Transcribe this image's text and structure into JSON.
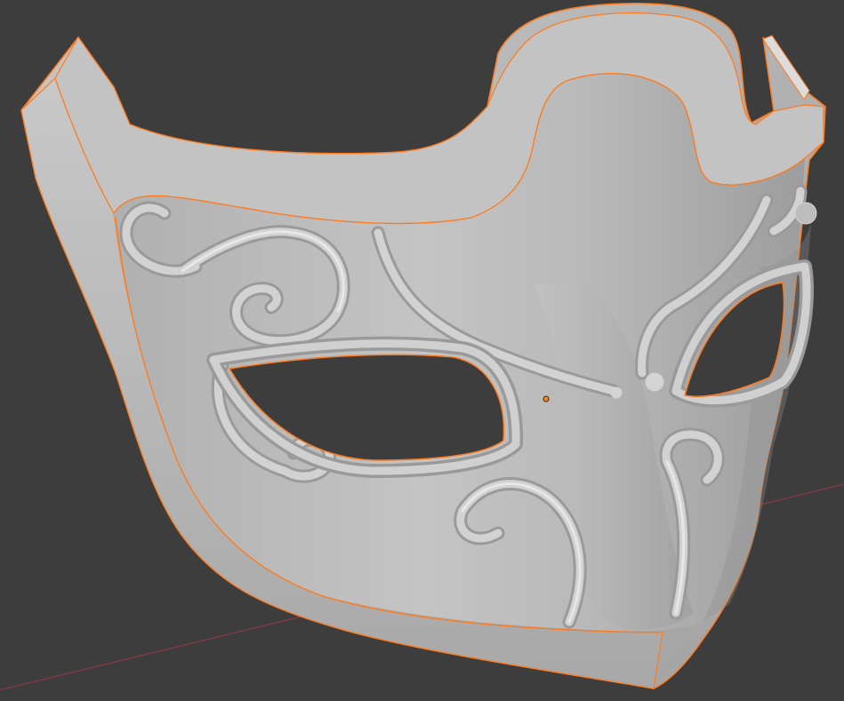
{
  "viewport": {
    "background": "#3d3d3d",
    "axis_colors": {
      "x": "#8a3a45",
      "y": "#5d7f2e"
    },
    "selection_outline_color": "#ff7a1c",
    "origin_dot_color": "#ff8a1a"
  },
  "object": {
    "kind": "mask-mesh",
    "selected": true,
    "shading": "solid",
    "base_color": "#b9b9b9"
  }
}
